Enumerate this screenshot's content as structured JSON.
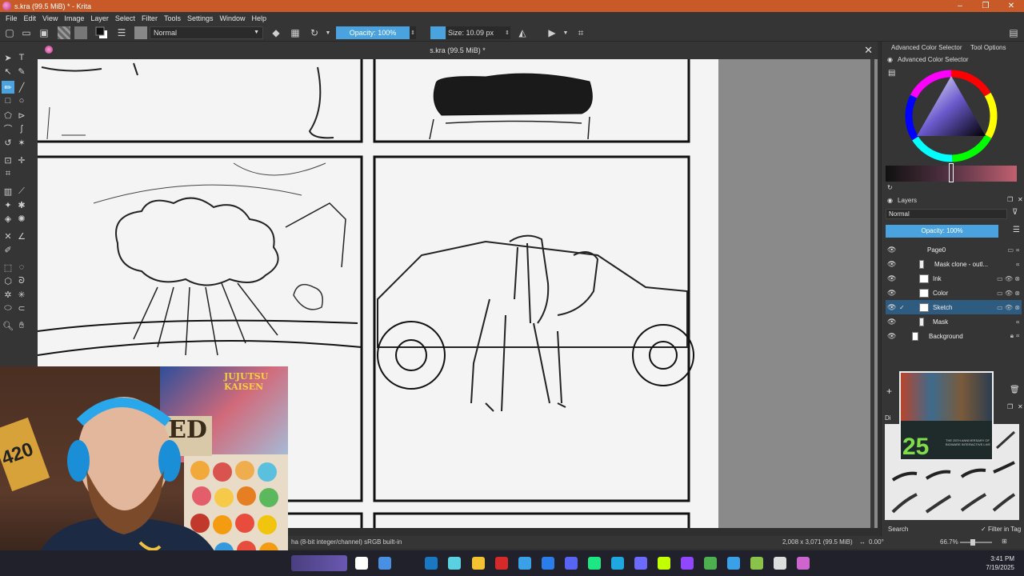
{
  "window": {
    "title": "s.kra (99.5 MiB) * - Krita",
    "controls": [
      "–",
      "❐",
      "✕"
    ]
  },
  "menu": [
    "File",
    "Edit",
    "View",
    "Image",
    "Layer",
    "Select",
    "Filter",
    "Tools",
    "Settings",
    "Window",
    "Help"
  ],
  "toolbar": {
    "blend_mode": "Normal",
    "opacity_label": "Opacity: 100%",
    "size_label": "Size: 10.09 px",
    "accent_color": "#4aa3df"
  },
  "document": {
    "tab_title": "s.kra (99.5 MiB) *",
    "close_glyph": "✕"
  },
  "dock": {
    "tab_color_selector": "Advanced Color Selector",
    "tab_tool_options": "Tool Options",
    "color_selector_title": "Advanced Color Selector",
    "layers_title": "Layers",
    "layers_blend_mode": "Normal",
    "layers_opacity": "Opacity: 100%",
    "layers": [
      {
        "name": "Page0",
        "selected": false,
        "type": "group"
      },
      {
        "name": "Mask clone - outl...",
        "selected": false,
        "type": "mask"
      },
      {
        "name": "Ink",
        "selected": false,
        "type": "paint"
      },
      {
        "name": "Color",
        "selected": false,
        "type": "paint"
      },
      {
        "name": "Sketch",
        "selected": true,
        "type": "paint"
      },
      {
        "name": "Mask",
        "selected": false,
        "type": "mask"
      },
      {
        "name": "Background",
        "selected": false,
        "type": "background"
      }
    ],
    "search_placeholder": "Search",
    "filter_in_tag": "Filter in Tag"
  },
  "statusbar": {
    "color_profile": "ha (8-bit integer/channel)  sRGB built-in",
    "dimensions": "2,008 x 3,071 (99.5 MiB)",
    "rotation": "0.00°",
    "zoom": "66.7%"
  },
  "webcam": {
    "poster_text": "JUJUTSU KAISEN",
    "sign_text": "420",
    "wanted_text": "ED"
  },
  "promo": {
    "big_number": "25",
    "caption": "THE 25TH ANNIVERSARY OF BIOWARE INTERACTIVE LIVE"
  },
  "taskbar": {
    "time": "3:41 PM",
    "date": "7/19/2025",
    "app_colors": [
      "#ffffff",
      "#4a90e2",
      "#1a78c2",
      "#5ad1e0",
      "#f2c230",
      "#d62a2a",
      "#3aa0e8",
      "#2b7de9",
      "#5865f2",
      "#1ce783",
      "#1fa7e0",
      "#6b6bff",
      "#c3ff00",
      "#9146ff",
      "#4caf50",
      "#3aa0e8",
      "#8bc34a",
      "#dddddd",
      "#cc66cc"
    ]
  }
}
